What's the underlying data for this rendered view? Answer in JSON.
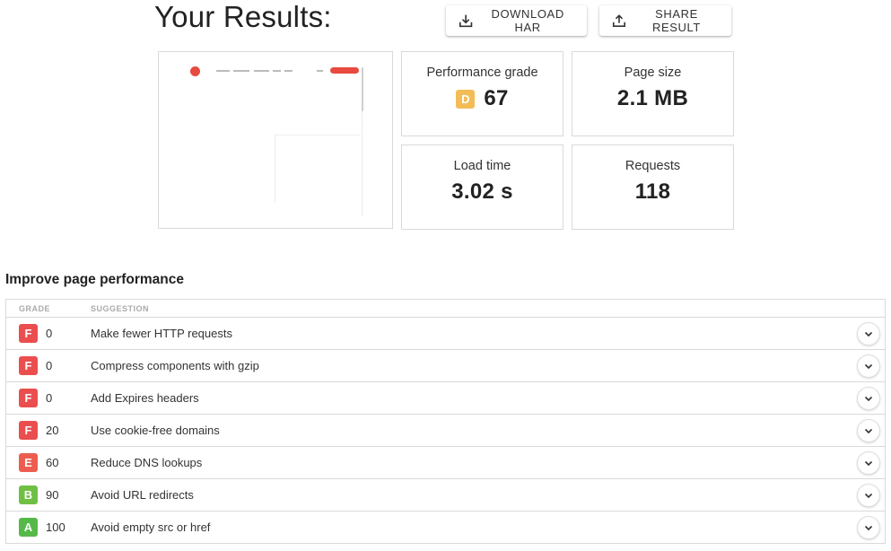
{
  "header": {
    "title": "Your Results:",
    "download_label": "DOWNLOAD HAR",
    "share_label": "SHARE RESULT",
    "download_icon": "download-icon",
    "share_icon": "share-icon"
  },
  "metrics": {
    "performance": {
      "label": "Performance grade",
      "grade": "D",
      "value": "67",
      "grade_color": "#f2bd57"
    },
    "page_size": {
      "label": "Page size",
      "value": "2.1 MB"
    },
    "load_time": {
      "label": "Load time",
      "value": "3.02 s"
    },
    "requests": {
      "label": "Requests",
      "value": "118"
    }
  },
  "section": {
    "title": "Improve page performance"
  },
  "table": {
    "headers": {
      "grade": "GRADE",
      "suggestion": "SUGGESTION"
    },
    "rows": [
      {
        "grade": "F",
        "score": "0",
        "suggestion": "Make fewer HTTP requests",
        "color": "#eb4e4e"
      },
      {
        "grade": "F",
        "score": "0",
        "suggestion": "Compress components with gzip",
        "color": "#eb4e4e"
      },
      {
        "grade": "F",
        "score": "0",
        "suggestion": "Add Expires headers",
        "color": "#eb4e4e"
      },
      {
        "grade": "F",
        "score": "20",
        "suggestion": "Use cookie-free domains",
        "color": "#eb4e4e"
      },
      {
        "grade": "E",
        "score": "60",
        "suggestion": "Reduce DNS lookups",
        "color": "#ec5d4f"
      },
      {
        "grade": "B",
        "score": "90",
        "suggestion": "Avoid URL redirects",
        "color": "#6fbf44"
      },
      {
        "grade": "A",
        "score": "100",
        "suggestion": "Avoid empty src or href",
        "color": "#54b948"
      }
    ]
  },
  "colors": {
    "accent": "#e84a3f"
  }
}
